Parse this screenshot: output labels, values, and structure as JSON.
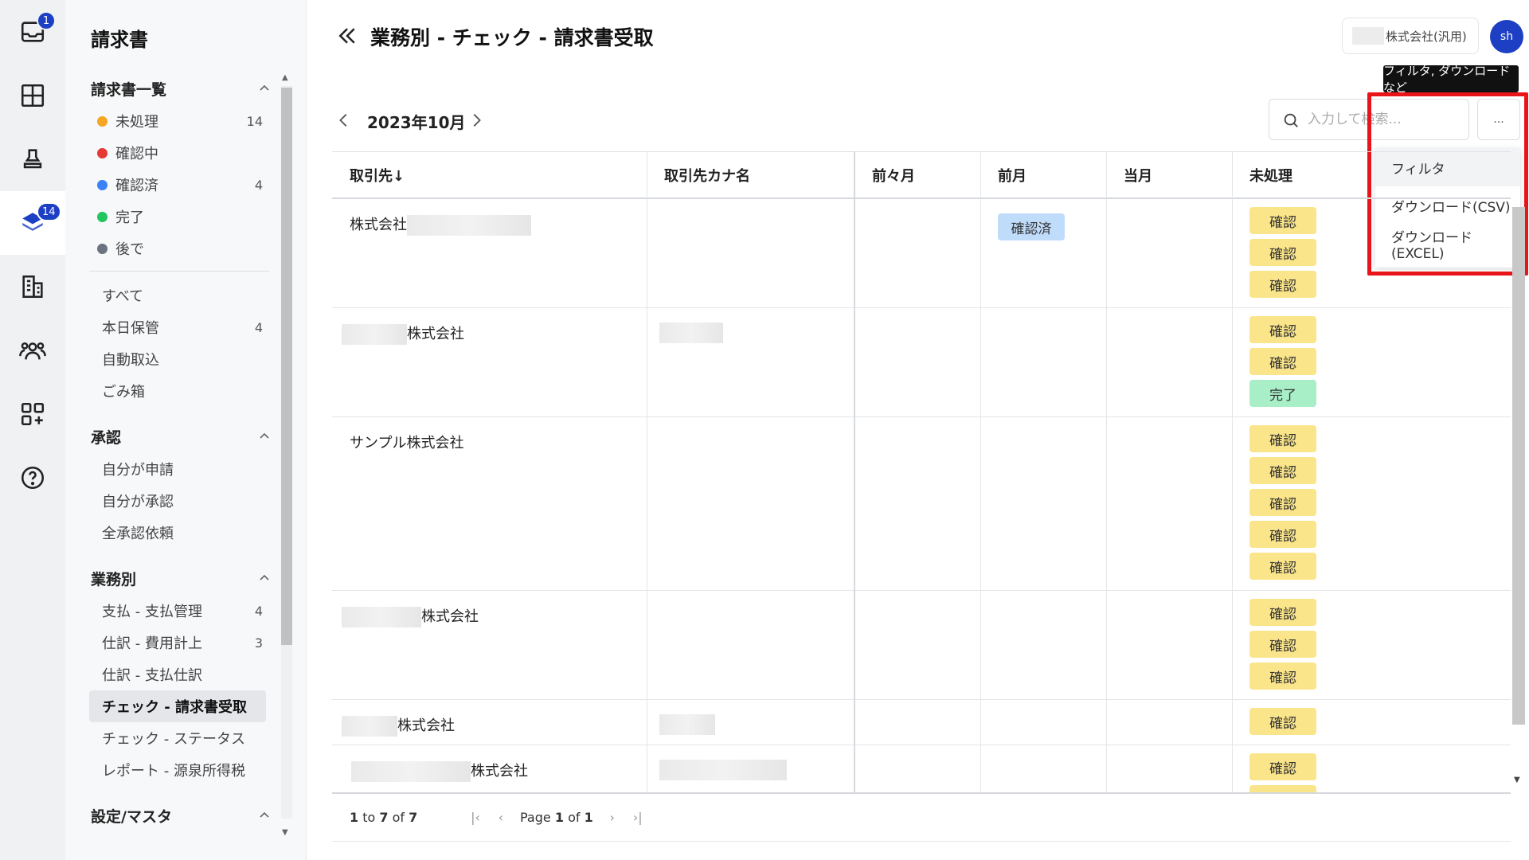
{
  "rail": {
    "inbox_badge": "1",
    "invoices_badge": "14"
  },
  "sidebar": {
    "title": "請求書",
    "sections": {
      "list": {
        "label": "請求書一覧",
        "items": [
          {
            "label": "未処理",
            "count": "14",
            "color": "#f5a623"
          },
          {
            "label": "確認中",
            "count": "",
            "color": "#e53935"
          },
          {
            "label": "確認済",
            "count": "4",
            "color": "#3b82f6"
          },
          {
            "label": "完了",
            "count": "",
            "color": "#22c55e"
          },
          {
            "label": "後で",
            "count": "",
            "color": "#6b7280"
          }
        ],
        "others": [
          {
            "label": "すべて",
            "count": ""
          },
          {
            "label": "本日保管",
            "count": "4"
          },
          {
            "label": "自動取込",
            "count": ""
          },
          {
            "label": "ごみ箱",
            "count": ""
          }
        ]
      },
      "approval": {
        "label": "承認",
        "items": [
          {
            "label": "自分が申請"
          },
          {
            "label": "自分が承認"
          },
          {
            "label": "全承認依頼"
          }
        ]
      },
      "workflow": {
        "label": "業務別",
        "items": [
          {
            "label": "支払 - 支払管理",
            "count": "4"
          },
          {
            "label": "仕訳 - 費用計上",
            "count": "3"
          },
          {
            "label": "仕訳 - 支払仕訳",
            "count": ""
          },
          {
            "label": "チェック - 請求書受取",
            "count": ""
          },
          {
            "label": "チェック - ステータス",
            "count": ""
          },
          {
            "label": "レポート - 源泉所得税",
            "count": ""
          }
        ]
      },
      "settings": {
        "label": "設定/マスタ"
      }
    }
  },
  "header": {
    "title": "業務別 - チェック - 請求書受取",
    "company": "株式会社(汎用)",
    "avatar": "sh"
  },
  "toolbar": {
    "month": "2023年10月",
    "search_placeholder": "入力して検索...",
    "more_label": "...",
    "tooltip": "フィルタ, ダウンロードなど",
    "menu": [
      "フィルタ",
      "ダウンロード(CSV)",
      "ダウンロード(EXCEL)"
    ]
  },
  "table": {
    "columns": [
      "取引先↓",
      "取引先カナ名",
      "前々月",
      "前月",
      "当月",
      "未処理"
    ],
    "rows": [
      {
        "vendor": "株式会社",
        "prev_month_status": "確認済",
        "pending": [
          "確認",
          "確認",
          "確認"
        ]
      },
      {
        "vendor": "株式会社",
        "pending": [
          "確認",
          "確認",
          "完了"
        ]
      },
      {
        "vendor": "サンプル株式会社",
        "pending": [
          "確認",
          "確認",
          "確認",
          "確認",
          "確認"
        ]
      },
      {
        "vendor": "株式会社",
        "pending": [
          "確認",
          "確認",
          "確認"
        ]
      },
      {
        "vendor": "株式会社",
        "pending": [
          "確認"
        ]
      },
      {
        "vendor": "株式会社",
        "pending": [
          "確認",
          "確認"
        ]
      }
    ]
  },
  "footer": {
    "range_from": "1",
    "range_to_word": "to",
    "range_to": "7",
    "range_of_word": "of",
    "range_total": "7",
    "page_word": "Page",
    "page_current": "1",
    "page_of_word": "of",
    "page_total": "1"
  }
}
